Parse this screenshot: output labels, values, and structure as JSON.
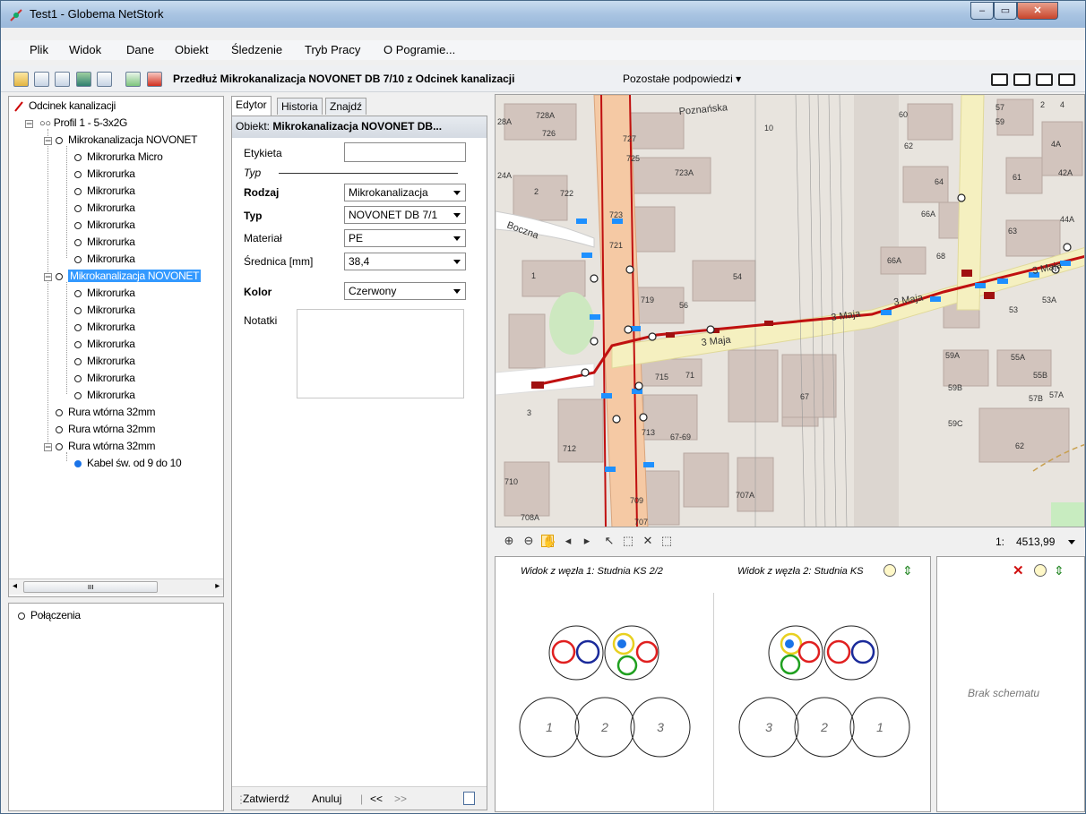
{
  "window": {
    "title": "Test1 - Globema NetStork",
    "min": "‒",
    "max": "▭",
    "close": "✕"
  },
  "menu": [
    "Plik",
    "Widok",
    "Dane",
    "Obiekt",
    "Śledzenie",
    "Tryb Pracy",
    "O Pogramie..."
  ],
  "toolbar": {
    "hint": "Przedłuż Mikrokanalizacja NOVONET DB 7/10 z Odcinek kanalizacji",
    "more": "Pozostałe podpowiedzi ▾"
  },
  "tree": {
    "root": "Odcinek kanalizacji",
    "profile": "Profil 1 - 5-3x2G",
    "mk1": "Mikrokanalizacja NOVONET",
    "mk1_items": [
      "Mikrorurka Micro",
      "Mikrorurka",
      "Mikrorurka",
      "Mikrorurka",
      "Mikrorurka",
      "Mikrorurka",
      "Mikrorurka"
    ],
    "mk2": "Mikrokanalizacja NOVONET",
    "mk2_items": [
      "Mikrorurka",
      "Mikrorurka",
      "Mikrorurka",
      "Mikrorurka",
      "Mikrorurka",
      "Mikrorurka",
      "Mikrorurka"
    ],
    "rura1": "Rura wtórna 32mm",
    "rura2": "Rura wtórna 32mm",
    "rura3": "Rura wtórna 32mm",
    "kabel": "Kabel św. od 9 do 10",
    "scroll_mark": "ııı"
  },
  "connections": {
    "label": "Połączenia"
  },
  "editor": {
    "tabs": [
      "Edytor",
      "Historia",
      "Znajdź"
    ],
    "object_label": "Obiekt:",
    "object_value": "Mikrokanalizacja NOVONET DB...",
    "etykieta": "Etykieta",
    "typ_section": "Typ",
    "rodzaj": "Rodzaj",
    "rodzaj_val": "Mikrokanalizacja",
    "typ": "Typ",
    "typ_val": "NOVONET DB 7/1",
    "material": "Materiał",
    "material_val": "PE",
    "srednica": "Średnica [mm]",
    "srednica_val": "38,4",
    "kolor": "Kolor",
    "kolor_val": "Czerwony",
    "notatki": "Notatki",
    "confirm": "Zatwierdź",
    "cancel": "Anuluj",
    "prev": "<<",
    "next": ">>"
  },
  "map": {
    "scale_prefix": "1:",
    "scale": "4513,99",
    "labels": [
      "Poznańska",
      "Boczna",
      "3 Maja",
      "3 Maja",
      "3 Maja",
      "3 Maja",
      "728A",
      "726",
      "727",
      "725",
      "723A",
      "722",
      "723",
      "721",
      "719",
      "56",
      "54",
      "715",
      "71",
      "713",
      "67-69",
      "712",
      "710",
      "709",
      "707A",
      "707",
      "708A",
      "28A",
      "24A",
      "2",
      "1",
      "3",
      "67",
      "60",
      "62",
      "64",
      "66A",
      "68",
      "66A",
      "57",
      "59",
      "4A",
      "42A",
      "61",
      "63",
      "44A",
      "53A",
      "53",
      "55A",
      "55B",
      "59A",
      "59B",
      "57B",
      "57A",
      "59C",
      "62",
      "2",
      "4",
      "10"
    ]
  },
  "schema": {
    "view1": "Widok z węzła 1: Studnia KS 2/2",
    "view2": "Widok z węzła 2: Studnia KS",
    "no_schema": "Brak schematu",
    "d1": [
      "1",
      "2",
      "3"
    ],
    "d2": [
      "3",
      "2",
      "1"
    ]
  },
  "colors": {
    "accent": "#3399ff",
    "cable": "#cc1111",
    "road": "#f5c9a4",
    "node": "#1e90ff"
  }
}
